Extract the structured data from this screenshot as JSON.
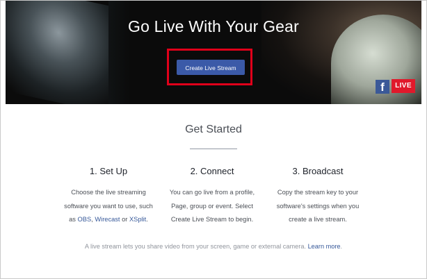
{
  "hero": {
    "title": "Go Live With Your Gear",
    "cta_label": "Create Live Stream",
    "badge_logo": "f",
    "badge_live": "LIVE"
  },
  "get_started": {
    "title": "Get Started"
  },
  "steps": [
    {
      "title": "1. Set Up",
      "line1": "Choose the live streaming",
      "line2": "software you want to use, such",
      "line3_prefix": "as ",
      "link_obs": "OBS",
      "sep1": ", ",
      "link_wirecast": "Wirecast",
      "sep2": " or ",
      "link_xsplit": "XSplit",
      "line3_suffix": "."
    },
    {
      "title": "2. Connect",
      "line1": "You can go live from a profile,",
      "line2": "Page, group or event. Select",
      "line3": "Create Live Stream to begin."
    },
    {
      "title": "3. Broadcast",
      "line1": "Copy the stream key to your",
      "line2": "software's settings when you",
      "line3": "create a live stream."
    }
  ],
  "footer": {
    "text": "A live stream lets you share video from your screen, game or external camera. ",
    "link": "Learn more",
    "suffix": "."
  },
  "colors": {
    "cta": "#3b5aa8",
    "highlight_box": "#e0001a",
    "link": "#365899",
    "live_badge": "#e0192b",
    "fb_badge": "#3b5998"
  }
}
